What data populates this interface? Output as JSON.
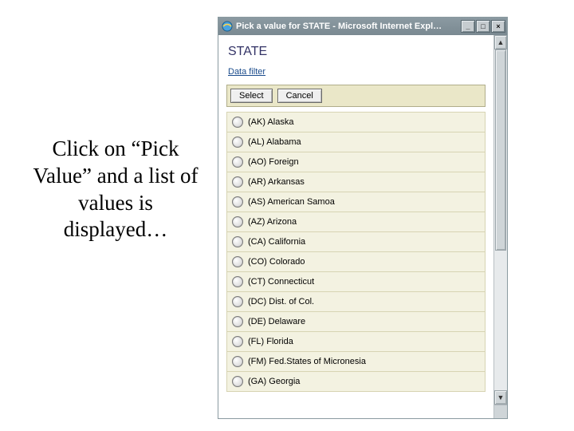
{
  "annotation": {
    "text": "Click on “Pick Value” and a list of values is displayed…"
  },
  "window": {
    "title": "Pick a value for STATE - Microsoft Internet Expl…"
  },
  "page": {
    "heading": "STATE",
    "filter_link": "Data filter",
    "select_label": "Select",
    "cancel_label": "Cancel"
  },
  "states": [
    {
      "label": "(AK) Alaska"
    },
    {
      "label": "(AL) Alabama"
    },
    {
      "label": "(AO) Foreign"
    },
    {
      "label": "(AR) Arkansas"
    },
    {
      "label": "(AS) American Samoa"
    },
    {
      "label": "(AZ) Arizona"
    },
    {
      "label": "(CA) California"
    },
    {
      "label": "(CO) Colorado"
    },
    {
      "label": "(CT) Connecticut"
    },
    {
      "label": "(DC) Dist. of Col."
    },
    {
      "label": "(DE) Delaware"
    },
    {
      "label": "(FL) Florida"
    },
    {
      "label": "(FM) Fed.States of Micronesia"
    },
    {
      "label": "(GA) Georgia"
    }
  ]
}
